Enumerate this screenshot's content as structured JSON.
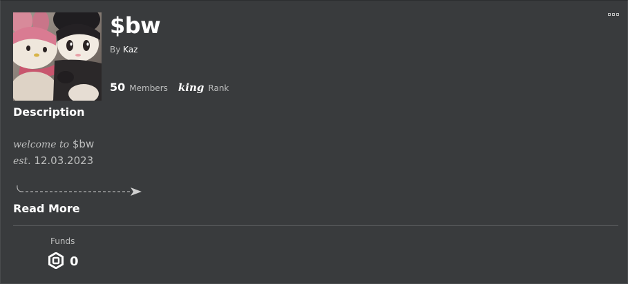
{
  "group": {
    "name": "$bw",
    "owner_prefix": "By",
    "owner_name": "Kaz",
    "member_count": "50",
    "members_label": "Members",
    "rank_value": "king",
    "rank_label": "Rank",
    "emblem_icon": "group-emblem-plush-photo"
  },
  "description": {
    "heading": "Description",
    "line1_italic": "welcome to",
    "line1_rest": "$bw",
    "line2_italic": "est.",
    "line2_rest": "12.03.2023",
    "arrow_icon": "dashed-arrow-icon"
  },
  "read_more_label": "Read More",
  "funds": {
    "label": "Funds",
    "value": "0",
    "currency_icon": "robux-icon"
  },
  "menu_icon": "more-options-icon",
  "colors": {
    "background": "#393b3d",
    "secondary_text": "#bdbebe",
    "primary_text": "#ffffff",
    "divider": "#5c5e60"
  }
}
